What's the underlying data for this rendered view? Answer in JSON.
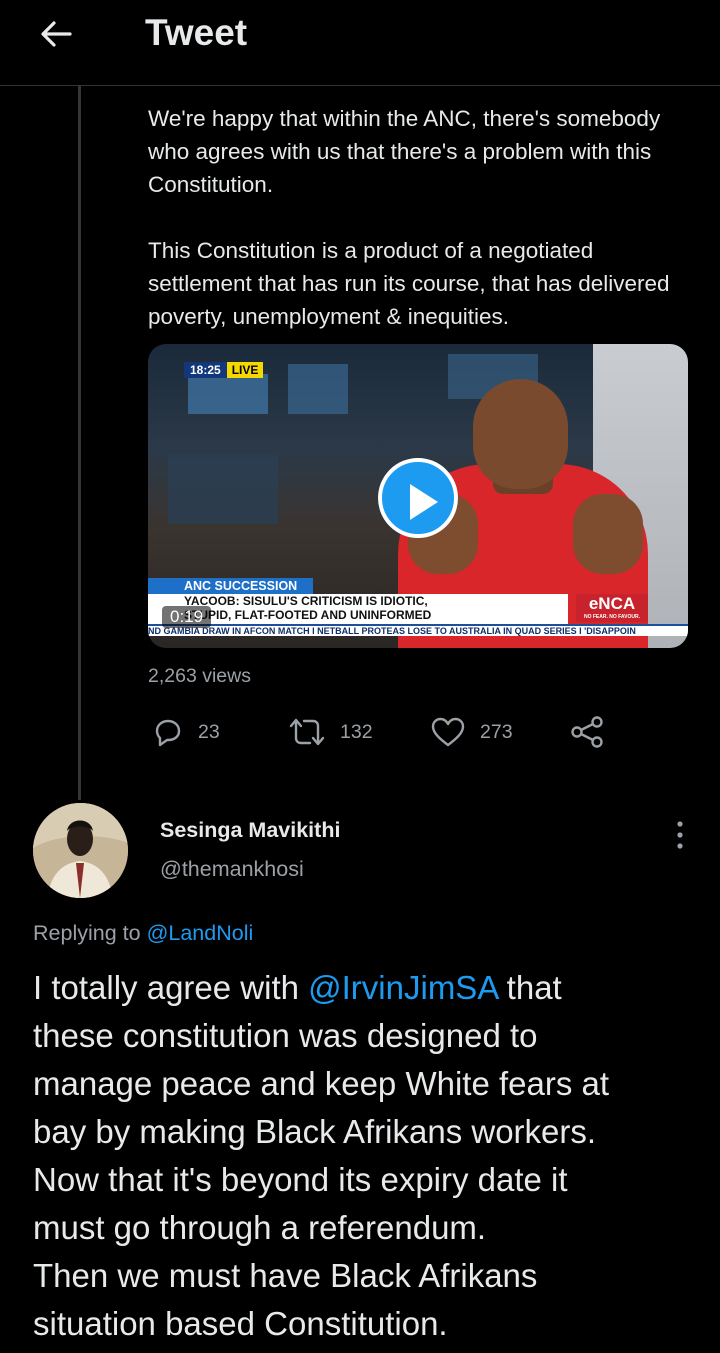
{
  "header": {
    "title": "Tweet"
  },
  "quoted_tweet": {
    "paragraph_1": "We're happy that within the ANC, there's somebody who agrees with us that there's a problem with this Constitution.",
    "paragraph_2": "This Constitution is a product of a negotiated settlement that has run its course, that has delivered poverty, unemployment & inequities.",
    "video": {
      "clock": "18:25",
      "live_label": "LIVE",
      "segment_tag": "ANC SUCCESSION",
      "headline_1": "YACOOB: SISULU'S CRITICISM IS IDIOTIC,",
      "headline_2": "STUPID, FLAT-FOOTED AND UNINFORMED",
      "ticker": "ND GAMBIA DRAW IN AFCON MATCH  I  NETBALL PROTEAS LOSE TO AUSTRALIA IN QUAD SERIES  I  'DISAPPOIN",
      "channel_logo": "eNCA",
      "channel_slogan": "NO FEAR. NO FAVOUR.",
      "duration": "0:19"
    },
    "views": "2,263 views",
    "stats": {
      "replies": "23",
      "retweets": "132",
      "likes": "273"
    }
  },
  "reply": {
    "name": "Sesinga Mavikithi",
    "handle": "@themankhosi",
    "replying_prefix": "Replying to",
    "replying_to": "@LandNoli",
    "text_line_1_pre": "I totally agree with ",
    "text_mention": "@IrvinJimSA",
    "text_line_1_post": " that",
    "text_line_2": "these constitution was designed to",
    "text_line_3": "manage peace and keep White fears at",
    "text_line_4": "bay by making Black Afrikans workers.",
    "text_line_5": "Now that it's beyond its expiry date it",
    "text_line_6": "must go through a referendum.",
    "text_line_7": "Then we must have Black Afrikans",
    "text_line_8": "situation based Constitution."
  },
  "colors": {
    "accent": "#1d9bf0",
    "secondary_text": "#9ba1a6",
    "background": "#000000"
  }
}
